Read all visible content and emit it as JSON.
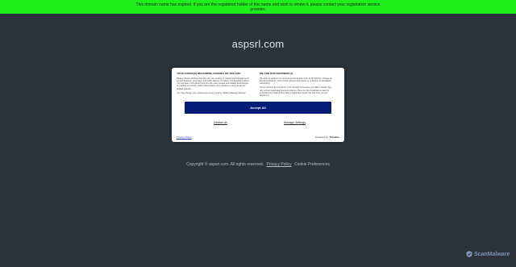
{
  "banner": {
    "text": "This domain name has expired. If you are the registered holder of this name and wish to renew it, please contact your registration service provider."
  },
  "page": {
    "domain_title": "aspsrl.com"
  },
  "cookie_dialog": {
    "left_heading": "YOUR CHOICE(S) REGARDING COOKIES ON THIS SITE",
    "left_body_1": "Please choose whether this site may use cookies or related technologies such as web beacons, pixel tags, and Flash objects (\"Cookies\") as described below. You can learn more about how this site uses cookies and related technologies by reading our privacy policy linked below. Your choices on this site will be applied globally.",
    "left_body_2": "You may change your preferences at any time by clicking Manage Settings.",
    "right_heading": "WE AND OUR PARTNERS (1)",
    "right_body_1": "We and our partners (1) process personal data such as IP Address, Unique ID, Browsing Data for: store and/or access information on a device, Personalised advertising.",
    "right_body_2": "Some partners do not ask for your consent to process your data, instead, they rely on their legitimate business interest. View our list of partners to see the purposes they believe they have a legitimate interest for and how you can object to it.",
    "accept_label": "Accept All",
    "decline_label": "Decline All",
    "manage_label": "Manage Settings",
    "privacy_policy_label": "Privacy Policy",
    "powered_by_label": "Powered by:",
    "powered_by_brand": "TrustArc"
  },
  "footer": {
    "copyright": "Copyright © aspsrl.com.  All rights reserved.",
    "privacy_link": "Privacy Policy",
    "preferences_link": "Cookie Preferences"
  },
  "watermark": {
    "text": "ScanMalware"
  },
  "colors": {
    "background": "#2b323a",
    "banner": "#1ff01b",
    "accept_button": "#041e78"
  }
}
